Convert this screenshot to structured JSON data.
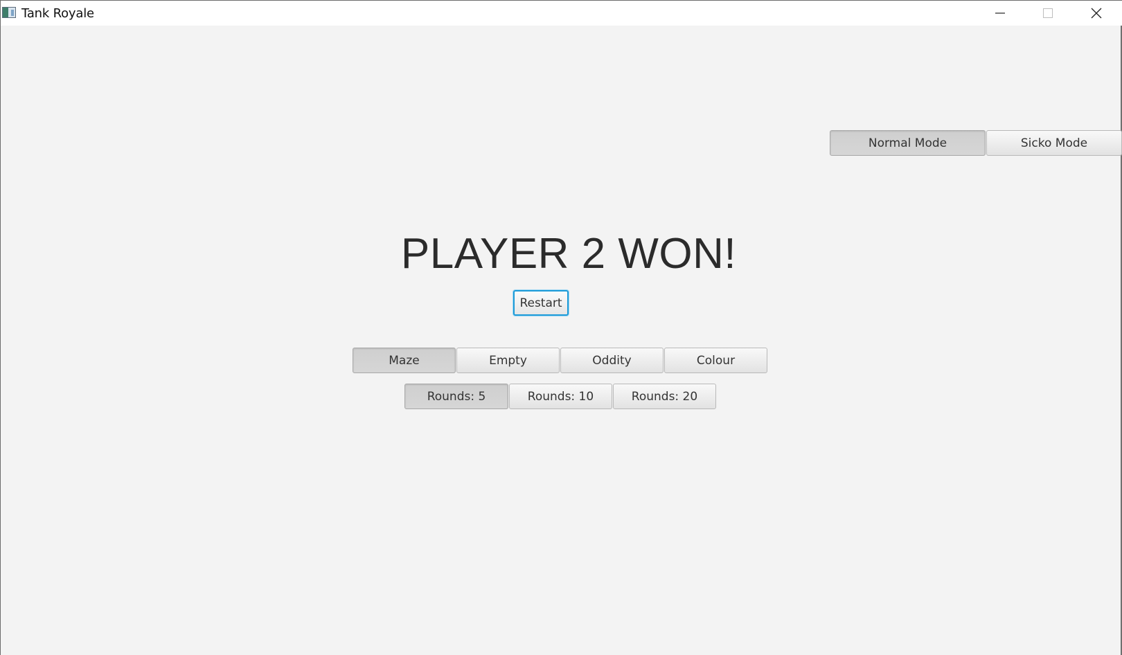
{
  "window": {
    "title": "Tank Royale",
    "controls": {
      "minimize_icon": "minimize-icon",
      "maximize_icon": "maximize-icon",
      "close_icon": "close-icon"
    }
  },
  "mode_toggle": {
    "options": [
      {
        "label": "Normal Mode",
        "selected": true
      },
      {
        "label": "Sicko Mode",
        "selected": false
      }
    ]
  },
  "result": {
    "headline": "PLAYER 2 WON!",
    "restart_label": "Restart"
  },
  "map_selector": {
    "options": [
      {
        "label": "Maze",
        "selected": true
      },
      {
        "label": "Empty",
        "selected": false
      },
      {
        "label": "Oddity",
        "selected": false
      },
      {
        "label": "Colour",
        "selected": false
      }
    ]
  },
  "rounds_selector": {
    "options": [
      {
        "label": "Rounds: 5",
        "selected": true
      },
      {
        "label": "Rounds: 10",
        "selected": false
      },
      {
        "label": "Rounds: 20",
        "selected": false
      }
    ]
  },
  "colors": {
    "background": "#f3f3f3",
    "focus_ring": "#1d9bd8",
    "text": "#333333"
  }
}
